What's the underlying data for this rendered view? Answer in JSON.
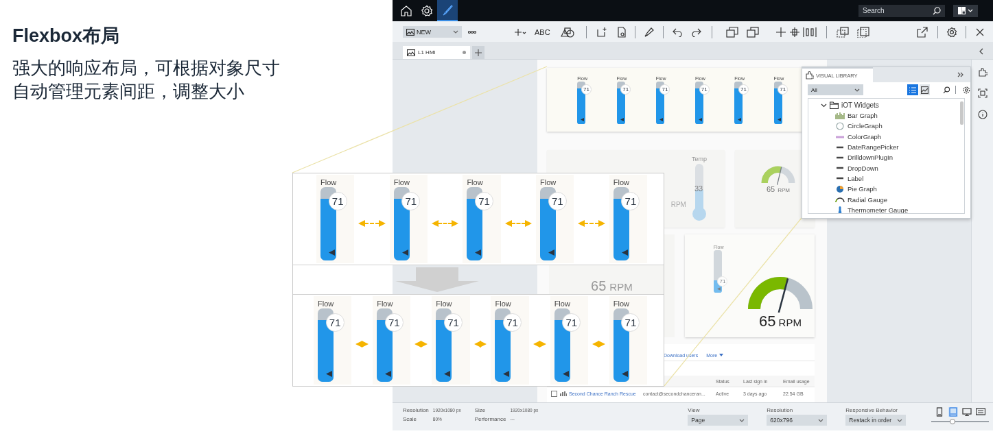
{
  "intro": {
    "title": "Flexbox布局",
    "description": [
      "强大的响应布局，可根据对象尺寸",
      "自动管理元素间距，调整大小"
    ]
  },
  "top_bar": {
    "nav": [
      {
        "kind": "home",
        "selected": false
      },
      {
        "kind": "settings",
        "selected": false
      },
      {
        "kind": "brush",
        "selected": true
      }
    ],
    "search": {
      "placeholder": "Search"
    }
  },
  "toolbar": {
    "new_menu": "NEW",
    "text_tool": "ABC"
  },
  "tabs": [
    {
      "label": "L1 HMI",
      "selected": true,
      "modified": true
    }
  ],
  "canvas": {
    "strip_gauges": [
      {
        "label": "Flow",
        "value": "71",
        "level": 0.84
      },
      {
        "label": "Flow",
        "value": "71",
        "level": 0.84
      },
      {
        "label": "Flow",
        "value": "71",
        "level": 0.84
      },
      {
        "label": "Flow",
        "value": "71",
        "level": 0.84
      },
      {
        "label": "Flow",
        "value": "71",
        "level": 0.84
      },
      {
        "label": "Flow",
        "value": "71",
        "level": 0.84
      }
    ],
    "partial_gauge": {
      "unit": "RPM"
    },
    "thermometer": {
      "label": "Temp",
      "value": "33",
      "level": 0.45
    },
    "small_gauge": {
      "value": "65",
      "unit": "RPM",
      "level": 0.6
    },
    "faded_gauge": {
      "value": "65",
      "unit": "RPM"
    },
    "faded_flow": {
      "label": "Flow",
      "value": "71",
      "level": 0.3
    },
    "big_gauge": {
      "value": "65",
      "unit": "RPM",
      "level": 0.62
    },
    "users_table": {
      "links": [
        {
          "label": "Download users",
          "kind": "link"
        },
        {
          "label": "More",
          "kind": "menu"
        }
      ],
      "columns": [
        "Status",
        "Last sign in",
        "Email usage"
      ],
      "rows": [
        {
          "checked": false,
          "name": "Second Chance Ranch Rescue",
          "email": "contact@secondchanceran...",
          "status": "Active",
          "last_sign_in": "3 days ago",
          "email_usage": "22.54 GB"
        }
      ]
    }
  },
  "visual_library": {
    "title": "VISUAL LIBRARY",
    "filter": "All",
    "views": [
      {
        "kind": "list",
        "selected": true
      },
      {
        "kind": "chart",
        "selected": false
      }
    ],
    "tree": [
      {
        "label": "iOT Widgets",
        "expanded": true,
        "children": [
          {
            "label": "Bar Graph",
            "kind": "bar"
          },
          {
            "label": "CircleGraph",
            "kind": "circle"
          },
          {
            "label": "ColorGraph",
            "kind": "color"
          },
          {
            "label": "DateRangePicker",
            "kind": "plain"
          },
          {
            "label": "DrilldownPlugIn",
            "kind": "plain"
          },
          {
            "label": "DropDown",
            "kind": "plain"
          },
          {
            "label": "Label",
            "kind": "plain"
          },
          {
            "label": "Pie Graph",
            "kind": "pie"
          },
          {
            "label": "Radial Gauge",
            "kind": "radial"
          },
          {
            "label": "Thermometer Gauge",
            "kind": "thermo"
          }
        ]
      }
    ]
  },
  "callout": {
    "before": [
      {
        "label": "Flow",
        "value": "71",
        "level": 0.84
      },
      {
        "label": "Flow",
        "value": "71",
        "level": 0.84
      },
      {
        "label": "Flow",
        "value": "71",
        "level": 0.84
      },
      {
        "label": "Flow",
        "value": "71",
        "level": 0.84
      },
      {
        "label": "Flow",
        "value": "71",
        "level": 0.84
      }
    ],
    "after": [
      {
        "label": "Flow",
        "value": "71",
        "level": 0.84
      },
      {
        "label": "Flow",
        "value": "71",
        "level": 0.84
      },
      {
        "label": "Flow",
        "value": "71",
        "level": 0.84
      },
      {
        "label": "Flow",
        "value": "71",
        "level": 0.84
      },
      {
        "label": "Flow",
        "value": "71",
        "level": 0.84
      },
      {
        "label": "Flow",
        "value": "71",
        "level": 0.84
      }
    ]
  },
  "status_bar": {
    "info": [
      {
        "label": "Resolution",
        "value": "1920x1080 px"
      },
      {
        "label": "Size",
        "value": "1920x1080 px"
      },
      {
        "label": "Scale",
        "value": "80%"
      },
      {
        "label": "Performance",
        "value": "---"
      }
    ],
    "selects": [
      {
        "label": "View",
        "value": "Page"
      },
      {
        "label": "Resolution",
        "value": "620x796"
      },
      {
        "label": "Responsive Behavior",
        "value": "Restack in order"
      }
    ],
    "devices": [
      {
        "kind": "phone",
        "selected": false
      },
      {
        "kind": "tablet",
        "selected": true
      },
      {
        "kind": "desktop",
        "selected": false
      },
      {
        "kind": "wide",
        "selected": false
      }
    ],
    "zoom": {
      "level": 0.37
    }
  }
}
